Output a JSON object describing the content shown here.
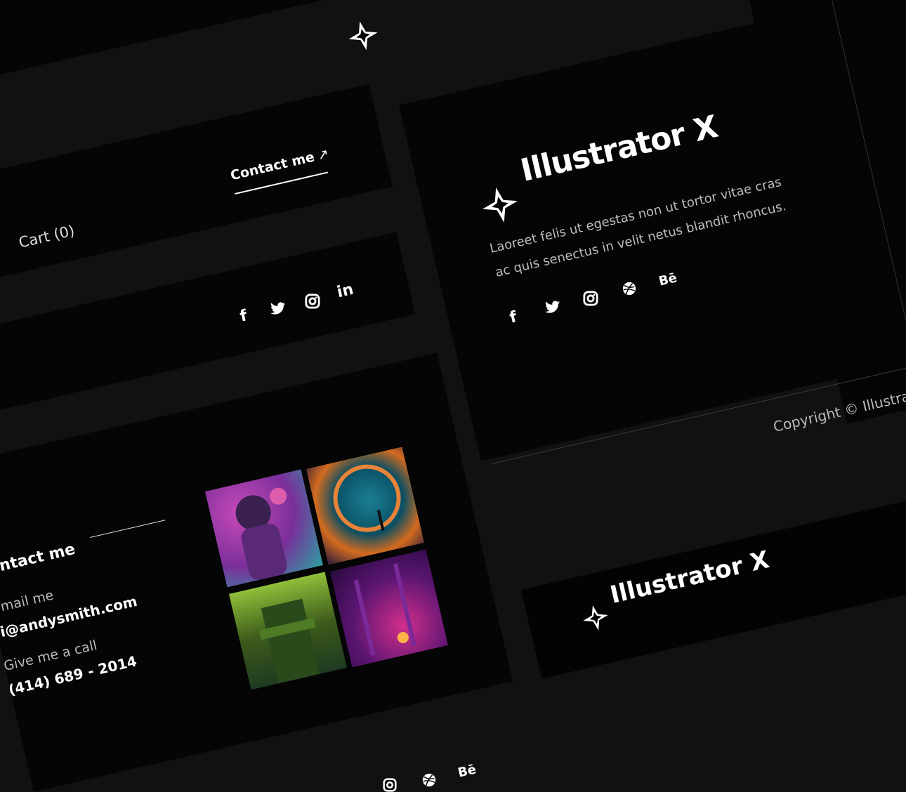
{
  "header": {
    "cart_label": "Cart (0)",
    "contact_label": "Contact me"
  },
  "brand": {
    "name": "Illustrator X",
    "description_line1": "Laoreet felis ut egestas non ut tortor vitae cras",
    "description_line2": "ac quis senectus in velit netus blandit rhoncus.",
    "copyright": "Copyright © Illustra"
  },
  "contact": {
    "heading": "ntact me",
    "email_label": "mail me",
    "email_value": "i@andysmith.com",
    "phone_label": "Give me a call",
    "phone_value": "(414) 689 - 2014"
  },
  "social": {
    "facebook": "f",
    "twitter": "twitter-icon",
    "instagram": "instagram-icon",
    "linkedin": "in",
    "dribbble": "dribbble-icon",
    "behance": "Bē"
  },
  "gallery": [
    {
      "name": "astronaut",
      "colors": [
        "#7a2f9b",
        "#c84ab8",
        "#2c9fa0"
      ]
    },
    {
      "name": "forest-portal",
      "colors": [
        "#0b4f63",
        "#d36b1f",
        "#2b1a3a"
      ]
    },
    {
      "name": "mossy-tower",
      "colors": [
        "#3d5b1a",
        "#8fbf3a",
        "#1f3a22"
      ]
    },
    {
      "name": "neon-forest",
      "colors": [
        "#5a1572",
        "#d12f8a",
        "#2a0b3f"
      ]
    }
  ],
  "colors": {
    "background": "#111111",
    "panel": "#050505",
    "text": "#ffffff",
    "muted": "#bdbdbd"
  }
}
